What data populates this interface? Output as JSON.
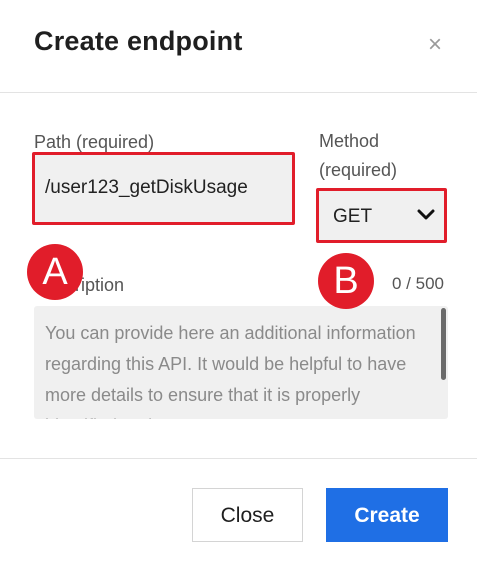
{
  "dialog": {
    "title": "Create endpoint",
    "close_icon": "×"
  },
  "path": {
    "label": "Path (required)",
    "value": "/user123_getDiskUsage"
  },
  "method": {
    "label": "Method (required)",
    "selected": "GET"
  },
  "description": {
    "label": "Description",
    "counter": "0 / 500",
    "placeholder": "You can provide here an additional information regarding this API. It would be helpful to have more details to ensure that it is properly identified and"
  },
  "annotations": {
    "marker_a": "A",
    "marker_b": "B",
    "color": "#e11d2a"
  },
  "footer": {
    "close_label": "Close",
    "create_label": "Create",
    "create_color": "#1f6fe5"
  }
}
